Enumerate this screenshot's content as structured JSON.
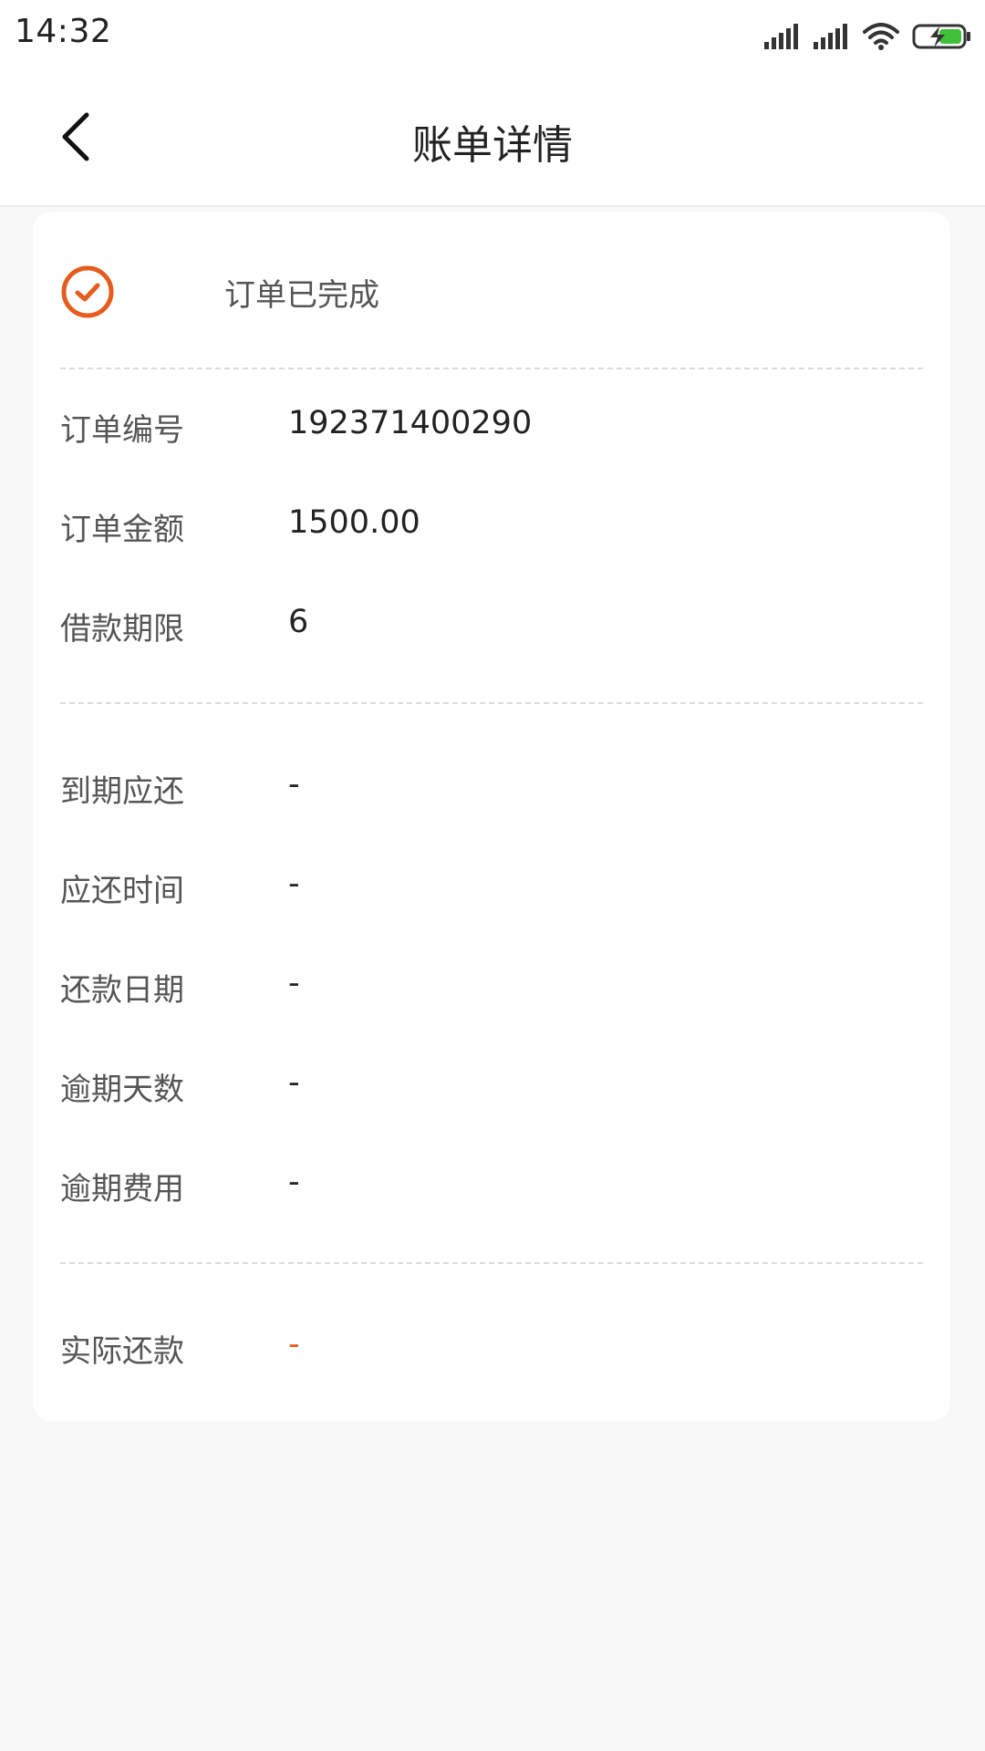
{
  "status_bar": {
    "time": "14:32",
    "icons": [
      "signal-icon",
      "signal-icon",
      "wifi-icon",
      "battery-charging-icon"
    ]
  },
  "app_bar": {
    "title": "账单详情",
    "back_icon": "chevron-left-icon"
  },
  "order": {
    "status_text": "订单已完成",
    "status_icon": "check-circle-icon",
    "accent_color": "#e65c1c",
    "details": [
      {
        "label": "订单编号",
        "value": "192371400290"
      },
      {
        "label": "订单金额",
        "value": "1500.00"
      },
      {
        "label": "借款期限",
        "value": "6"
      }
    ],
    "repayment": [
      {
        "label": "到期应还",
        "value": "-"
      },
      {
        "label": "应还时间",
        "value": "-"
      },
      {
        "label": "还款日期",
        "value": "-"
      },
      {
        "label": "逾期天数",
        "value": "-"
      },
      {
        "label": "逾期费用",
        "value": "-"
      }
    ],
    "actual": {
      "label": "实际还款",
      "value": "-"
    }
  }
}
